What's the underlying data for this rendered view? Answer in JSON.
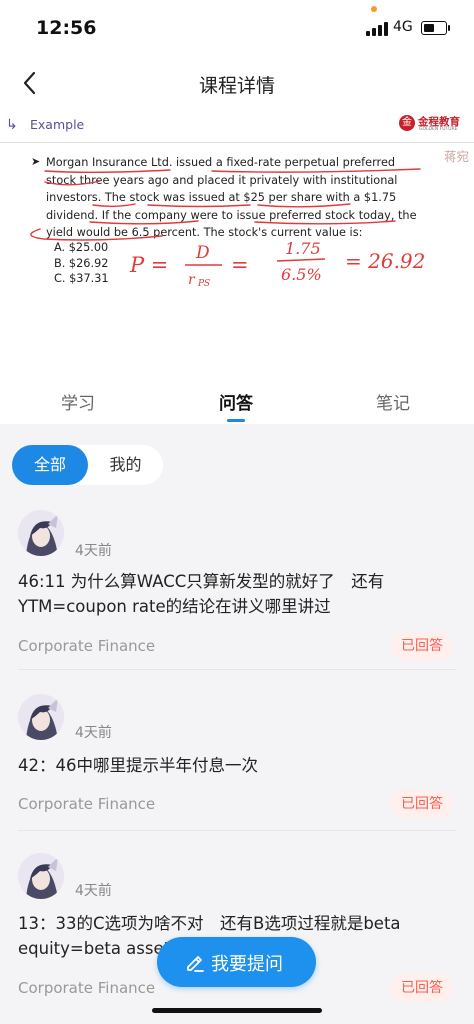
{
  "status_bar": {
    "time": "12:56",
    "network": "4G"
  },
  "navbar": {
    "title": "课程详情"
  },
  "slide": {
    "header": "Example",
    "brand_name": "金程教育",
    "brand_sub": "GOLDEN FUTURE",
    "watermark": "蒋宛",
    "question": "Morgan Insurance Ltd. issued a fixed-rate perpetual preferred stock three years ago and placed it privately with institutional investors. The stock was issued at $25 per share with a $1.75 dividend. If the company were to issue preferred stock today, the yield would be 6.5 percent. The stock's current value is:",
    "options": [
      "A. $25.00",
      "B. $26.92",
      "C. $37.31"
    ],
    "handwriting": "P = D / rps = 1.75 / 6.5% = 26.92"
  },
  "tabs": [
    {
      "label": "学习",
      "active": false
    },
    {
      "label": "问答",
      "active": true
    },
    {
      "label": "笔记",
      "active": false
    }
  ],
  "filters": {
    "all": "全部",
    "mine": "我的"
  },
  "questions": [
    {
      "time_ago": "4天前",
      "text": "46:11 为什么算WACC只算新发型的就好了　还有YTM=coupon rate的结论在讲义哪里讲过",
      "course": "Corporate Finance",
      "status": "已回答"
    },
    {
      "time_ago": "4天前",
      "text": "42：46中哪里提示半年付息一次",
      "course": "Corporate Finance",
      "status": "已回答"
    },
    {
      "time_ago": "4天前",
      "text": "13：33的C选项为啥不对　还有B选项过程就是beta equity=beta asset……吧",
      "course": "Corporate Finance",
      "status": "已回答"
    }
  ],
  "ask_button": {
    "label": "我要提问"
  },
  "colors": {
    "accent": "#1e88e5",
    "answered": "#ff5b4e",
    "brand": "#c8202a",
    "ink": "#e23a3a"
  }
}
